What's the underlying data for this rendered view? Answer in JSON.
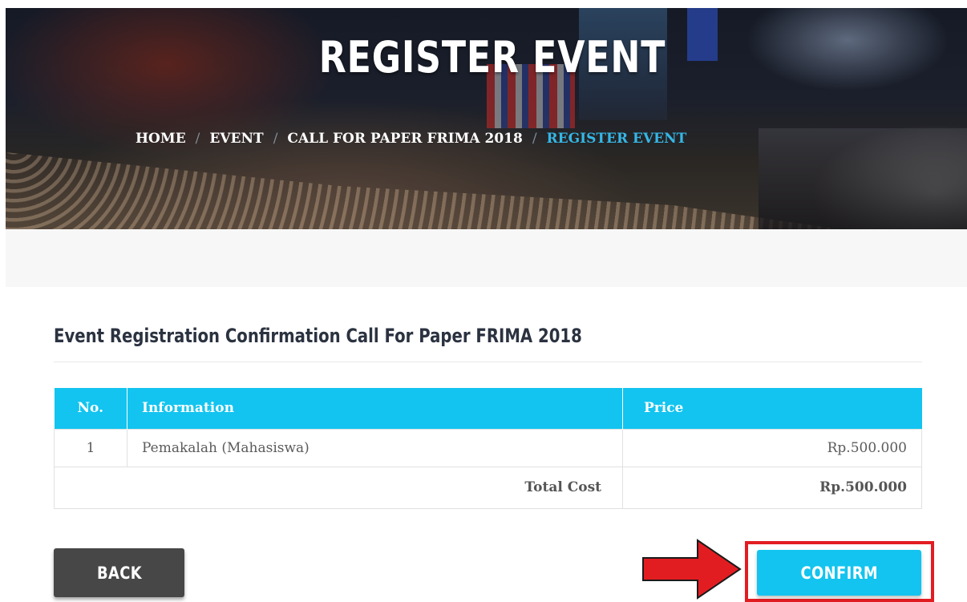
{
  "hero": {
    "title": "REGISTER EVENT",
    "breadcrumb": [
      "HOME",
      "EVENT",
      "CALL FOR PAPER FRIMA 2018",
      "REGISTER EVENT"
    ],
    "breadcrumb_separator": "/"
  },
  "main": {
    "heading": "Event Registration Confirmation Call For Paper FRIMA 2018",
    "table": {
      "headers": {
        "no": "No.",
        "information": "Information",
        "price": "Price"
      },
      "rows": [
        {
          "no": "1",
          "information": "Pemakalah (Mahasiswa)",
          "price": "Rp.500.000"
        }
      ],
      "total_label": "Total Cost",
      "total_value": "Rp.500.000"
    }
  },
  "actions": {
    "back_label": "BACK",
    "confirm_label": "CONFIRM"
  },
  "colors": {
    "accent": "#12c4ef",
    "back_button": "#474747",
    "highlight": "#e21d22",
    "breadcrumb_active": "#35b7e6"
  },
  "icons": {
    "annotation_arrow": "right-arrow-icon"
  }
}
